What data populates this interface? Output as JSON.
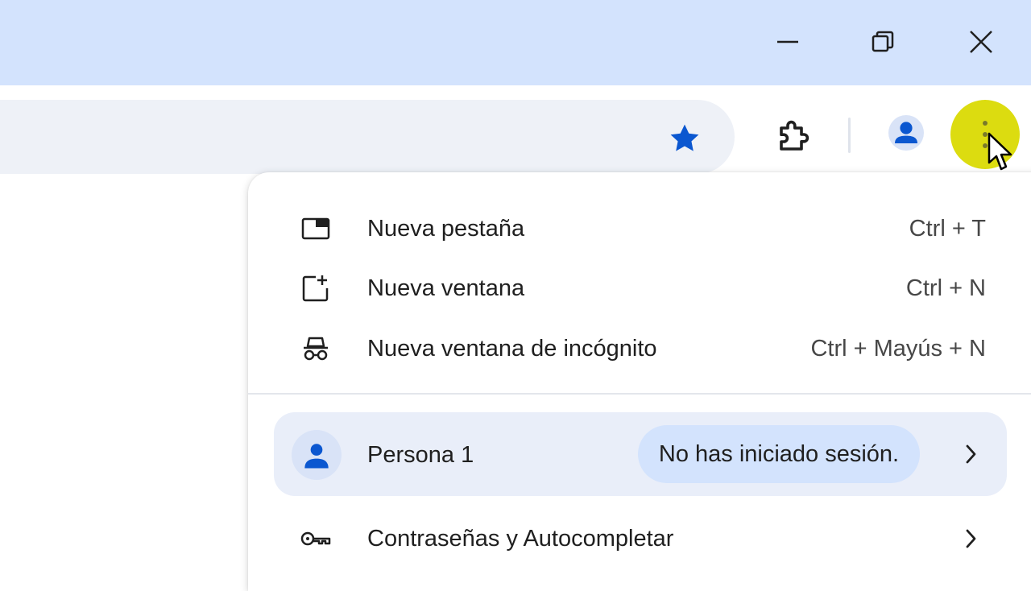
{
  "window_controls": {
    "minimize_icon": "minimize-icon",
    "restore_icon": "restore-icon",
    "close_icon": "close-icon"
  },
  "toolbar": {
    "bookmark_icon": "star-icon",
    "extensions_icon": "puzzle-piece-icon",
    "profile_icon": "person-icon",
    "menu_icon": "kebab-menu-icon"
  },
  "colors": {
    "titlebar": "#d3e3fd",
    "accent": "#0b57d0",
    "highlight": "#dcdc10",
    "pill": "#d3e3fd",
    "profile_row": "#e9eef9"
  },
  "menu": {
    "items": [
      {
        "label": "Nueva pestaña",
        "shortcut": "Ctrl + T",
        "icon": "new-tab-icon"
      },
      {
        "label": "Nueva ventana",
        "shortcut": "Ctrl + N",
        "icon": "new-window-icon"
      },
      {
        "label": "Nueva ventana de incógnito",
        "shortcut": "Ctrl + Mayús + N",
        "icon": "incognito-icon"
      }
    ],
    "profile": {
      "name": "Persona 1",
      "status": "No has iniciado sesión.",
      "icon": "person-icon"
    },
    "passwords": {
      "label": "Contraseñas y Autocompletar",
      "icon": "key-icon"
    }
  }
}
